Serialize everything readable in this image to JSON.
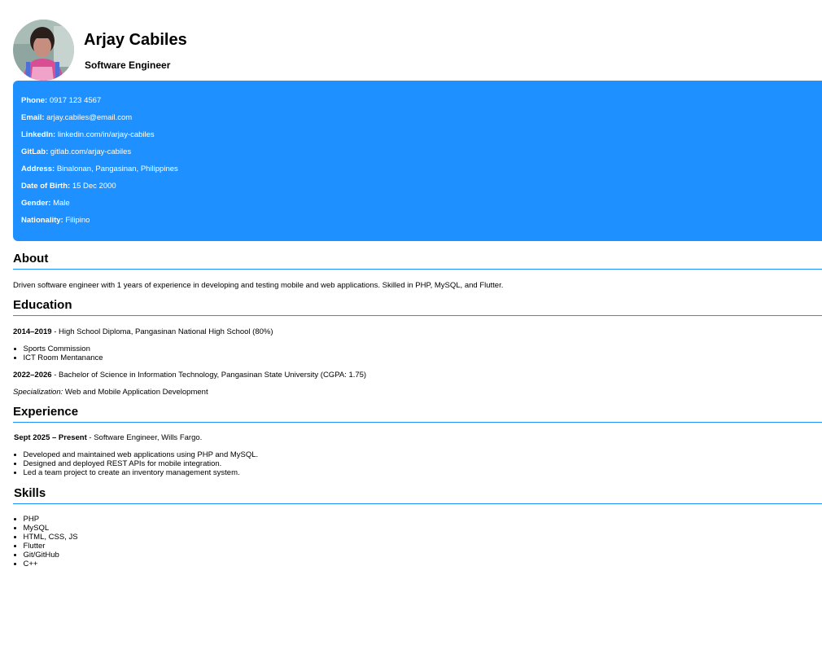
{
  "profile": {
    "name": "Arjay Cabiles",
    "title": "Software Engineer",
    "avatar_icon": "profile-photo"
  },
  "contact": [
    {
      "label": "Phone:",
      "value": "0917 123 4567"
    },
    {
      "label": "Email:",
      "value": "arjay.cabiles@email.com"
    },
    {
      "label": "LinkedIn:",
      "value": "linkedin.com/in/arjay-cabiles"
    },
    {
      "label": "GitLab:",
      "value": "gitlab.com/arjay-cabiles"
    },
    {
      "label": "Address:",
      "value": "Binalonan, Pangasinan, Philippines"
    },
    {
      "label": "Date of Birth:",
      "value": "15 Dec 2000"
    },
    {
      "label": "Gender:",
      "value": "Male"
    },
    {
      "label": "Nationality:",
      "value": "Filipino"
    }
  ],
  "about": {
    "heading": "About",
    "text": "Driven software engineer with 1 years of experience in developing and testing mobile and web applications. Skilled in PHP, MySQL, and Flutter."
  },
  "education": {
    "heading": "Education",
    "entries": [
      {
        "years": "2014–2019",
        "detail": " - High School Diploma, Pangasinan National High School (80%)"
      },
      {
        "years": "2022–2026",
        "detail": " - Bachelor of Science in Information Technology, Pangasinan State University (CGPA: 1.75)"
      }
    ],
    "highlights": [
      "Sports Commission",
      "ICT Room Mentanance"
    ],
    "specialization_label": "Specialization:",
    "specialization_value": " Web and Mobile Application Development"
  },
  "experience": {
    "heading": "Experience",
    "period": "Sept 2025 – Present",
    "role": " - Software Engineer, Wills Fargo.",
    "bullets": [
      "Developed and maintained web applications using PHP and MySQL.",
      "Designed and deployed REST APIs for mobile integration.",
      "Led a team project to create an inventory management system."
    ]
  },
  "skills": {
    "heading": "Skills",
    "items": [
      "PHP",
      "MySQL",
      "HTML, CSS, JS",
      "Flutter",
      "Git/GitHub",
      "C++"
    ]
  },
  "colors": {
    "accent": "#1e90ff",
    "contact_text": "#ffffff"
  }
}
